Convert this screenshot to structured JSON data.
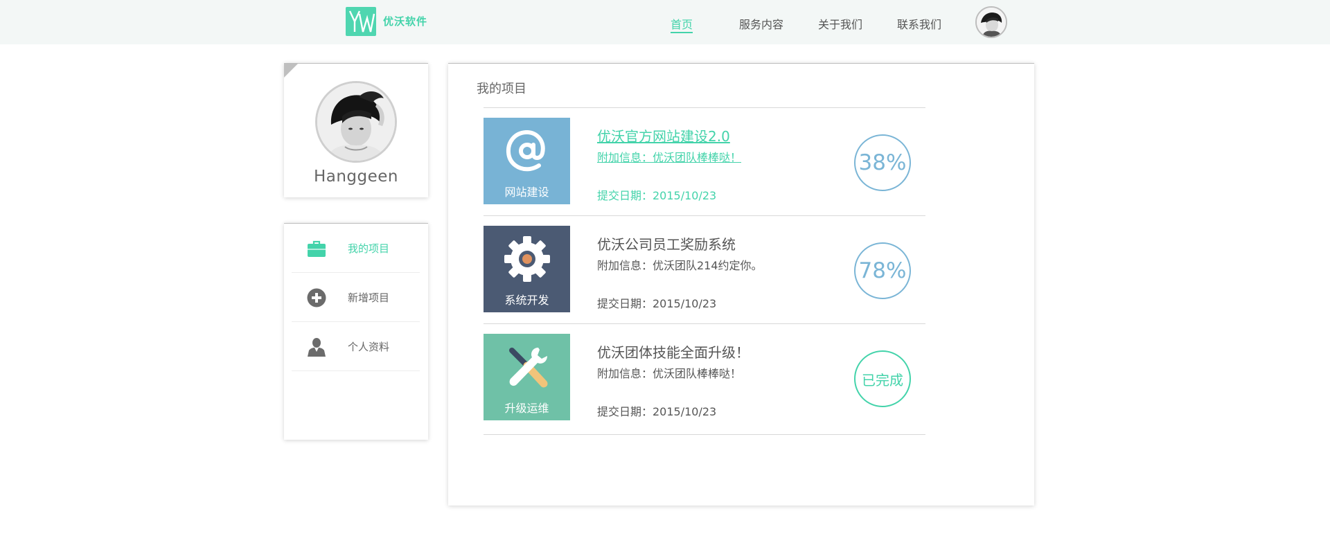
{
  "header": {
    "brand": "优沃软件",
    "logo_text": "YW",
    "nav": [
      {
        "label": "首页",
        "active": true
      },
      {
        "label": "服务内容",
        "active": false
      },
      {
        "label": "关于我们",
        "active": false
      },
      {
        "label": "联系我们",
        "active": false
      }
    ]
  },
  "profile": {
    "name": "Hanggeen"
  },
  "sidebar": {
    "items": [
      {
        "label": "我的项目",
        "icon": "briefcase-icon",
        "active": true
      },
      {
        "label": "新增项目",
        "icon": "plus-circle-icon",
        "active": false
      },
      {
        "label": "个人资料",
        "icon": "user-icon",
        "active": false
      }
    ]
  },
  "main": {
    "title": "我的项目",
    "projects": [
      {
        "tile_label": "网站建设",
        "tile_icon": "at-sign-icon",
        "tile_color": "#78b3d5",
        "title": "优沃官方网站建设2.0",
        "info": "附加信息：优沃团队棒棒哒！",
        "date": "提交日期：2015/10/23",
        "badge": "38%"
      },
      {
        "tile_label": "系统开发",
        "tile_icon": "gear-icon",
        "tile_color": "#4b5a73",
        "title": "优沃公司员工奖励系统",
        "info": "附加信息：优沃团队214约定你。",
        "date": "提交日期：2015/10/23",
        "badge": "78%"
      },
      {
        "tile_label": "升级运维",
        "tile_icon": "tools-icon",
        "tile_color": "#6fc1a7",
        "title": "优沃团体技能全面升级！",
        "info": "附加信息：优沃团队棒棒哒！",
        "date": "提交日期：2015/10/23",
        "badge": "已完成"
      }
    ]
  },
  "colors": {
    "accent": "#43d3aa",
    "badge_blue": "#7ab5d6",
    "header_bg": "#f3f7f6"
  }
}
